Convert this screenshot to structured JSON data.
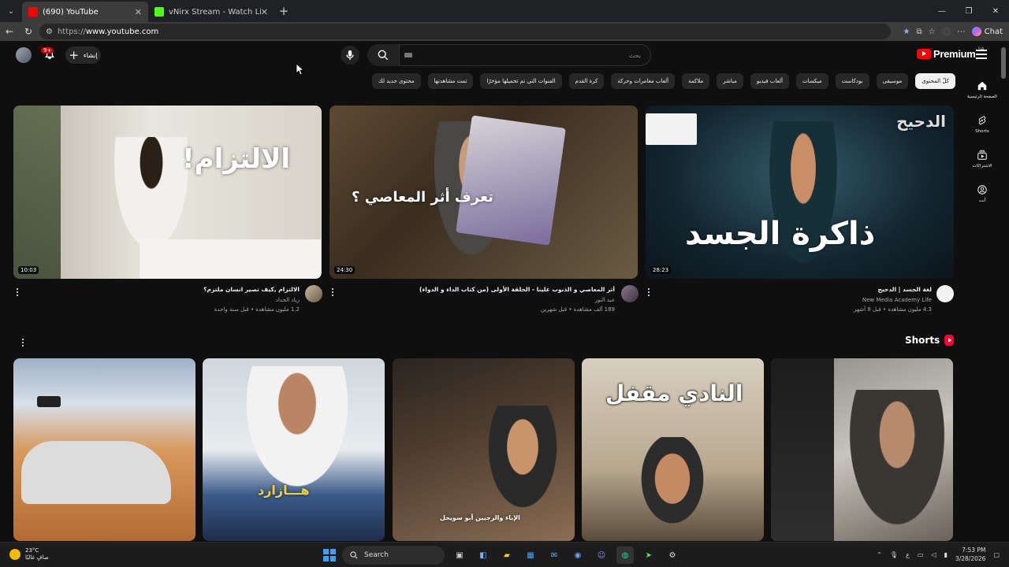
{
  "browser": {
    "tabs": [
      {
        "title": "(690) YouTube",
        "active": true,
        "favicon_color": "#ff0000"
      },
      {
        "title": "vNirx Stream - Watch Live on Kick",
        "active": false,
        "favicon_color": "#53fc18"
      }
    ],
    "new_tab_symbol": "+",
    "url_scheme": "https://",
    "url_host": "www.youtube.com",
    "chat_label": "Chat"
  },
  "header": {
    "notification_count": "9+",
    "create_label": "إنشاء",
    "search_placeholder": "بحث",
    "logo_word": "Premium",
    "country_code": "SA"
  },
  "chips": [
    {
      "label": "كلّ المحتوى",
      "selected": true
    },
    {
      "label": "موسيقى"
    },
    {
      "label": "بودكاست"
    },
    {
      "label": "ميكسات"
    },
    {
      "label": "ألعاب فيديو"
    },
    {
      "label": "مباشر"
    },
    {
      "label": "ملاكمة"
    },
    {
      "label": "ألعاب مغامرات وحركة"
    },
    {
      "label": "كرة القدم"
    },
    {
      "label": "الفنوات التي تم تحميلها مؤخرًا"
    },
    {
      "label": "تمت مشاهدتها"
    },
    {
      "label": "محتوى جديد لك"
    }
  ],
  "rail": [
    {
      "label": "الصفحة الرئيسية",
      "icon": "home-icon"
    },
    {
      "label": "Shorts",
      "icon": "shorts-icon"
    },
    {
      "label": "الاشتراكات",
      "icon": "subscriptions-icon"
    },
    {
      "label": "أنت",
      "icon": "you-icon"
    }
  ],
  "videos": [
    {
      "title": "الالتزام ,كيف تصير انسان ملتزم؟",
      "channel": "زياد الحداد",
      "meta": "1.2 مليون مشاهدة • قبل سنة واحدة",
      "duration": "10:03",
      "overlay": "الالتزام!"
    },
    {
      "title": "أثر المعاصي و الذنوب علينا - الحلقة الأولى (من كتاب الداء و الدواء)",
      "channel": "عبد النور",
      "meta": "189 ألف مشاهدة • قبل شهرين",
      "duration": "24:30",
      "overlay": "تعرف أثر المعاصي ؟"
    },
    {
      "title": "لغة الجسد | الدحيح",
      "channel": "New Media Academy Life",
      "meta": "4.3 مليون مشاهدة • قبل 8 أشهر",
      "duration": "28:23",
      "overlay": "ذاكرة الجسد",
      "brand": "الدحيح"
    }
  ],
  "shorts_section": {
    "title": "Shorts"
  },
  "shorts": [
    {
      "caption": ""
    },
    {
      "caption": "هـــازارد"
    },
    {
      "caption": "الإباء والرجيين أبو سويحل"
    },
    {
      "caption": "النادي مقفل"
    },
    {
      "caption": ""
    }
  ],
  "taskbar": {
    "temperature": "23°C",
    "weather_desc": "صافٍ غالبًا",
    "search_label": "Search",
    "time": "7:53 PM",
    "date": "3/28/2026",
    "lang": "ع"
  },
  "colors": {
    "accent": "#ff0000",
    "bg": "#0f0f0f",
    "chip": "#272727"
  }
}
